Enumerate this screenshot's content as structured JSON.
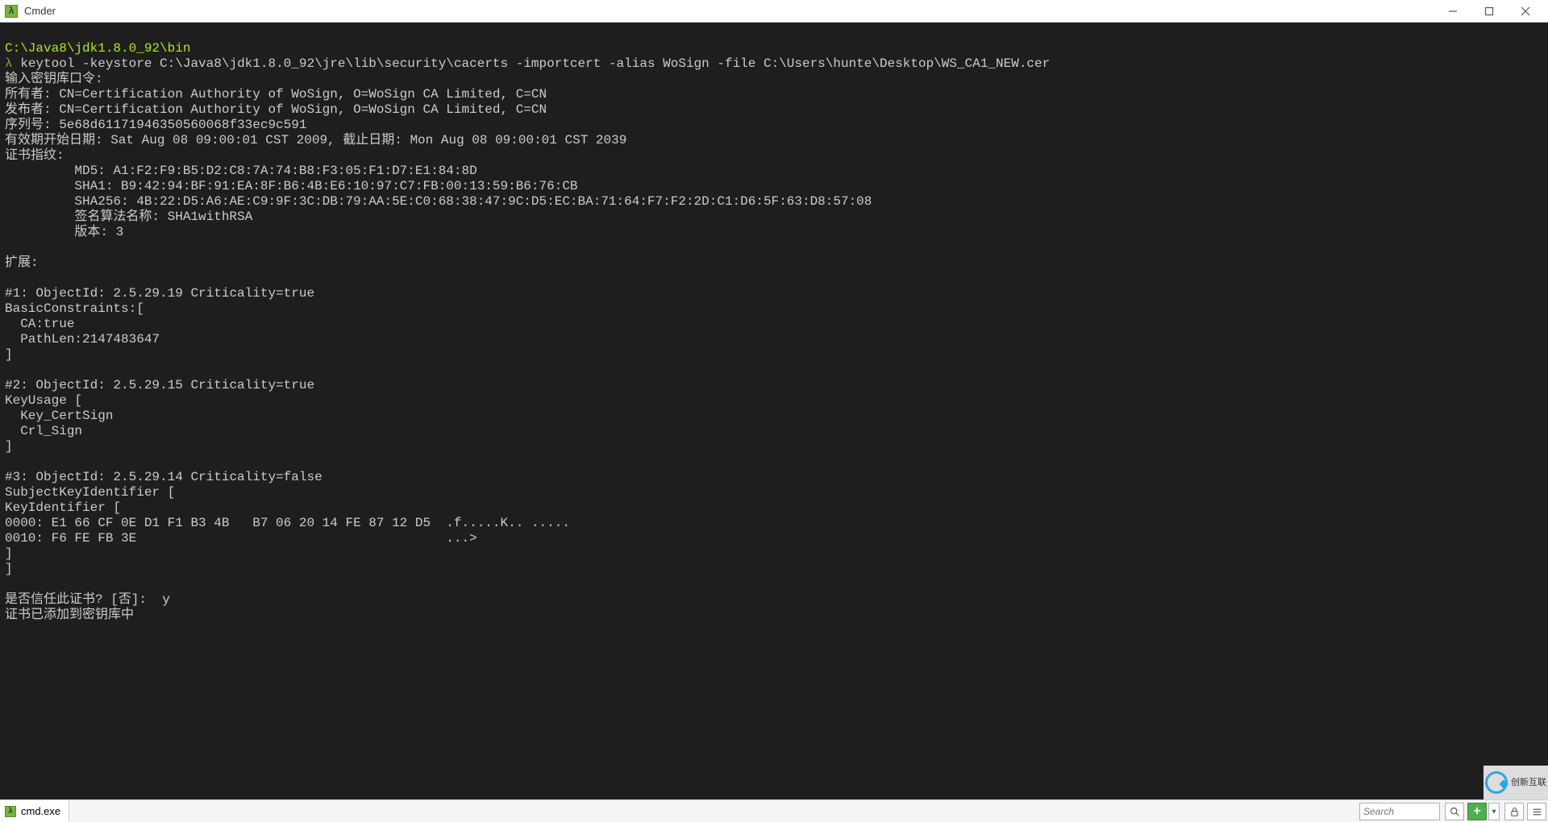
{
  "window": {
    "title": "Cmder"
  },
  "terminal": {
    "cwd": "C:\\Java8\\jdk1.8.0_92\\bin",
    "prompt_symbol": "λ",
    "command": "keytool -keystore C:\\Java8\\jdk1.8.0_92\\jre\\lib\\security\\cacerts -importcert -alias WoSign -file C:\\Users\\hunte\\Desktop\\WS_CA1_NEW.cer",
    "lines": {
      "l01": "输入密钥库口令:",
      "l02": "所有者: CN=Certification Authority of WoSign, O=WoSign CA Limited, C=CN",
      "l03": "发布者: CN=Certification Authority of WoSign, O=WoSign CA Limited, C=CN",
      "l04": "序列号: 5e68d61171946350560068f33ec9c591",
      "l05": "有效期开始日期: Sat Aug 08 09:00:01 CST 2009, 截止日期: Mon Aug 08 09:00:01 CST 2039",
      "l06": "证书指纹:",
      "l07": "         MD5: A1:F2:F9:B5:D2:C8:7A:74:B8:F3:05:F1:D7:E1:84:8D",
      "l08": "         SHA1: B9:42:94:BF:91:EA:8F:B6:4B:E6:10:97:C7:FB:00:13:59:B6:76:CB",
      "l09": "         SHA256: 4B:22:D5:A6:AE:C9:9F:3C:DB:79:AA:5E:C0:68:38:47:9C:D5:EC:BA:71:64:F7:F2:2D:C1:D6:5F:63:D8:57:08",
      "l10": "         签名算法名称: SHA1withRSA",
      "l11": "         版本: 3",
      "l12": "",
      "l13": "扩展:",
      "l14": "",
      "l15": "#1: ObjectId: 2.5.29.19 Criticality=true",
      "l16": "BasicConstraints:[",
      "l17": "  CA:true",
      "l18": "  PathLen:2147483647",
      "l19": "]",
      "l20": "",
      "l21": "#2: ObjectId: 2.5.29.15 Criticality=true",
      "l22": "KeyUsage [",
      "l23": "  Key_CertSign",
      "l24": "  Crl_Sign",
      "l25": "]",
      "l26": "",
      "l27": "#3: ObjectId: 2.5.29.14 Criticality=false",
      "l28": "SubjectKeyIdentifier [",
      "l29": "KeyIdentifier [",
      "l30": "0000: E1 66 CF 0E D1 F1 B3 4B   B7 06 20 14 FE 87 12 D5  .f.....K.. .....",
      "l31": "0010: F6 FE FB 3E                                        ...>",
      "l32": "]",
      "l33": "]",
      "l34": "",
      "l35": "是否信任此证书? [否]:  y",
      "l36": "证书已添加到密钥库中"
    }
  },
  "status": {
    "tab_label": "cmd.exe",
    "search_placeholder": "Search",
    "add_label": "+"
  },
  "watermark": {
    "text": "创新互联"
  }
}
